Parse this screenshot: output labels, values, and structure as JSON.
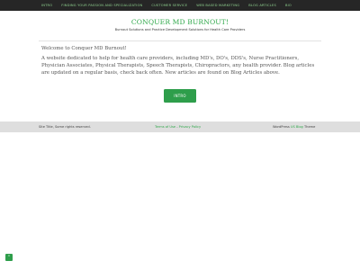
{
  "nav": {
    "items": [
      "Intro",
      "Finding Your Passion and Specialization",
      "Customer Service",
      "Web Based Marketing",
      "Blog Articles",
      "Bio"
    ]
  },
  "header": {
    "title": "CONQUER MD BURNOUT!",
    "tagline": "Burnout Solutions and Practice Development Solutions for Health Care Providers"
  },
  "main": {
    "welcome": "Welcome to Conquer MD Burnout!",
    "body": "A website dedicated to help for health care providers, including MD's, DO's, DDS's, Nurse Practitioners, Physician Associates, Physical Therapists, Speech Therapists, Chiropractors, any health provider.  Blog articles are updated on a regular basis, check back often.  New articles are found on Blog Articles above.",
    "button_label": "INTRO"
  },
  "footer": {
    "copyright": "Site Title, Some rights reserved.",
    "terms": "Terms of Use",
    "separator": " - ",
    "privacy": "Privacy Policy",
    "credit_prefix": "WordPress ",
    "credit_link": "US Blog",
    "credit_suffix": " Theme"
  },
  "colors": {
    "accent": "#2e9e4b",
    "nav_bg": "#262626",
    "footer_bg": "#dedede"
  },
  "icons": {
    "scroll_top": "chevron-up-icon"
  }
}
